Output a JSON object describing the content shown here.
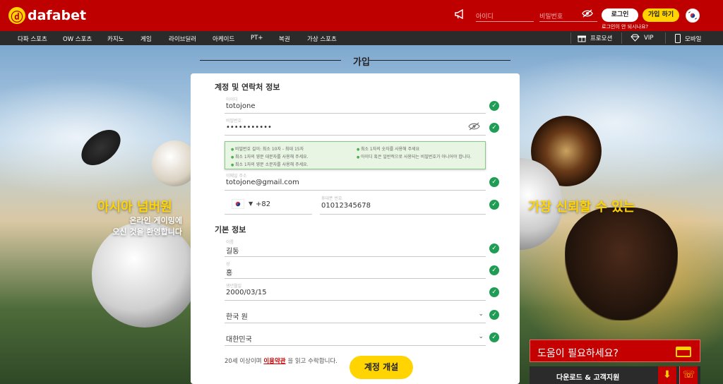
{
  "header": {
    "brand": "dafabet",
    "username_placeholder": "아이디",
    "password_placeholder": "비밀번호",
    "login_label": "로그인",
    "join_label": "가입 하기",
    "forgot_label": "로그인이 안 되시나요?"
  },
  "nav": {
    "items": [
      "다파 스포츠",
      "OW 스포츠",
      "카지노",
      "게임",
      "라이브딜러",
      "아케이드",
      "PT+",
      "복권",
      "가상 스포츠"
    ],
    "promo": "프로모션",
    "vip": "VIP",
    "mobile": "모바일"
  },
  "page": {
    "title": "가입"
  },
  "form": {
    "section_account": "계정 및 연락처 정보",
    "username_label": "아이디",
    "username_value": "totojone",
    "password_label": "비밀번호",
    "password_value": "•••••••••••",
    "tips_left": [
      "비밀번호 길이: 최소 10자 - 최대 15자",
      "최소 1자의 영문 대문자를 사용해 주세요.",
      "최소 1자의 영문 소문자를 사용해 주세요."
    ],
    "tips_right": [
      "최소 1자의 숫자를 사용해 주세요",
      "아이디 혹은 일반적으로 사용되는 비밀번호가 아니어야 합니다."
    ],
    "email_label": "이메일 주소",
    "email_value": "totojone@gmail.com",
    "country_code": "+82",
    "phone_label": "휴대폰 번호",
    "phone_value": "01012345678",
    "section_basic": "기본 정보",
    "firstname_label": "이름",
    "firstname_value": "길동",
    "lastname_label": "성",
    "lastname_value": "홍",
    "dob_label": "생년월일",
    "dob_value": "2000/03/15",
    "currency_value": "한국 원",
    "country_value": "대한민국",
    "terms_prefix": "20세 이상이며",
    "terms_link": "이용약관",
    "terms_suffix": "을 읽고 수락합니다.",
    "submit_label": "계정 개설"
  },
  "promo": {
    "left_line1": "아시아 넘버원",
    "left_line2": "온라인 게이밍에",
    "left_line3": "오신 것을 환영합니다",
    "right_line1": "가장 신뢰할 수 있는"
  },
  "help": {
    "label": "도움이 필요하세요?",
    "download_label": "다운로드 & 고객지원"
  },
  "colors": {
    "brand_red": "#bf0000",
    "accent_yellow": "#ffd400",
    "check_green": "#1f9d55"
  },
  "icons": [
    "megaphone-icon",
    "eye-slash-icon",
    "korea-flag-icon",
    "gift-icon",
    "diamond-icon",
    "mobile-icon",
    "check-icon",
    "chevron-down-icon",
    "chat-icon",
    "download-icon"
  ]
}
